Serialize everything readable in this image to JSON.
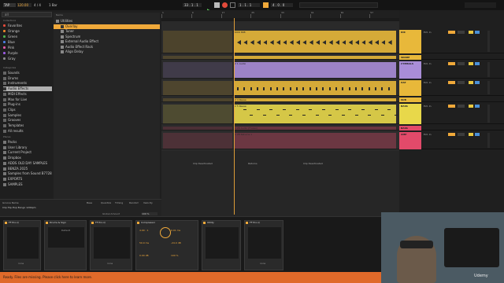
{
  "transport": {
    "tempo": "120.00",
    "time_sig": "4 / 4",
    "metro": "1 Bar",
    "position": "33 . 1 . 1",
    "loop_start": "1 . 1 . 1",
    "loop_len": "4 . 0 . 0"
  },
  "browser": {
    "search_placeholder": "all",
    "collections_header": "Collections",
    "collections": [
      {
        "label": "Favorites",
        "color": "#e24a3a"
      },
      {
        "label": "Orange",
        "color": "#e8822a"
      },
      {
        "label": "Green",
        "color": "#4fb24f"
      },
      {
        "label": "Blue",
        "color": "#4a7fe0"
      },
      {
        "label": "Pink",
        "color": "#e05aa6"
      },
      {
        "label": "Purple",
        "color": "#9a5ae0"
      },
      {
        "label": "Gray",
        "color": "#8a8a8a"
      }
    ],
    "categories_header": "Categories",
    "categories": [
      "Sounds",
      "Drums",
      "Instruments",
      "Audio Effects",
      "MIDI Effects",
      "Max for Live",
      "Plug-ins",
      "Clips",
      "Samples",
      "Grooves",
      "Templates",
      "All results"
    ],
    "places_header": "Places",
    "places": [
      "Packs",
      "User Library",
      "Current Project",
      "Dropbox",
      "ADDS OLD DAY SAMPLES",
      "BENZA 2025",
      "Samples from Sound B7728",
      "EXPORTS",
      "SAMPLES"
    ],
    "list_header": "Name",
    "list_items": [
      {
        "label": "Utilities",
        "selected": false
      },
      {
        "label": "Overlay",
        "selected": true
      },
      {
        "label": "Tuner",
        "selected": false
      },
      {
        "label": "Spectrum",
        "selected": false
      },
      {
        "label": "External Audio Effect",
        "selected": false
      },
      {
        "label": "Audio Effect Rack",
        "selected": false
      },
      {
        "label": "Align Delay",
        "selected": false
      }
    ],
    "groove_header": "Groove Name",
    "groove_cols": [
      "Base",
      "Quantize",
      "Timing",
      "Random",
      "Velocity"
    ],
    "groove_item": "Clip Hip-Hop Bongo 120bpm",
    "global_amount_label": "Global Amount",
    "global_amount_value": "100 %"
  },
  "ruler": {
    "bars": [
      "1",
      "9",
      "17",
      "25",
      "33",
      "41",
      "49",
      "57",
      "65"
    ]
  },
  "tracks": [
    {
      "name": "KIK",
      "color": "#e8b83a",
      "clip_label": "KICK 808",
      "type": "midi"
    },
    {
      "name": "SNARE",
      "color": "#e8b83a",
      "clip_label": "",
      "type": "midi"
    },
    {
      "name": "CYMBALS",
      "color": "#a98dd8",
      "clip_label": "2 1 Audio",
      "type": "audio"
    },
    {
      "name": "HAT",
      "color": "#e8b83a",
      "clip_label": "",
      "type": "midi"
    },
    {
      "name": "SUB",
      "color": "#e8b83a",
      "clip_label": "2 4 Reese",
      "type": "midi"
    },
    {
      "name": "BASS",
      "color": "#e8d84a",
      "clip_label": "2 5 Reese",
      "type": "midi"
    },
    {
      "name": "BASS",
      "color": "#e24a6a",
      "clip_label": "2 26 Audio (Frozen)",
      "type": "audio"
    },
    {
      "name": "AMP",
      "color": "#e24a6a",
      "clip_label": "1 28 Returns 1",
      "type": "midi"
    }
  ],
  "lower_clips": [
    "Clip Deactivated",
    "Returns",
    "Clip Deactivated"
  ],
  "mixer": {
    "master_label": "Master",
    "in_label": "Ext. In",
    "group_label": "20 Group"
  },
  "devices": [
    {
      "title": "FF Pro-Q",
      "label": "none"
    },
    {
      "title": "Drums & Sign",
      "label": "Default"
    },
    {
      "title": "FF Pro-Q",
      "label": "none"
    },
    {
      "title": "Compressor",
      "label": ""
    },
    {
      "title": "Utility",
      "label": ""
    },
    {
      "title": "FF Pro-Q",
      "label": "none"
    }
  ],
  "compressor": {
    "ratio": "4.00 : 1",
    "attack": "0.01 ms",
    "release": "50.0 ms",
    "threshold": "-24.0 dB",
    "out": "0.00 dB",
    "dry_wet": "100 %"
  },
  "status_bar": {
    "message": "Ready. Files are missing. Please click here to learn more."
  },
  "watermark": "Udemy",
  "colors": {
    "accent_orange": "#f0a93a",
    "arrangement_bg": "#2a2a2a",
    "kick_clip": "#e8d84a",
    "cymbal_clip": "#a98dd8",
    "hat_clip": "#e9a838",
    "bass_clip": "#7fd1e3"
  }
}
